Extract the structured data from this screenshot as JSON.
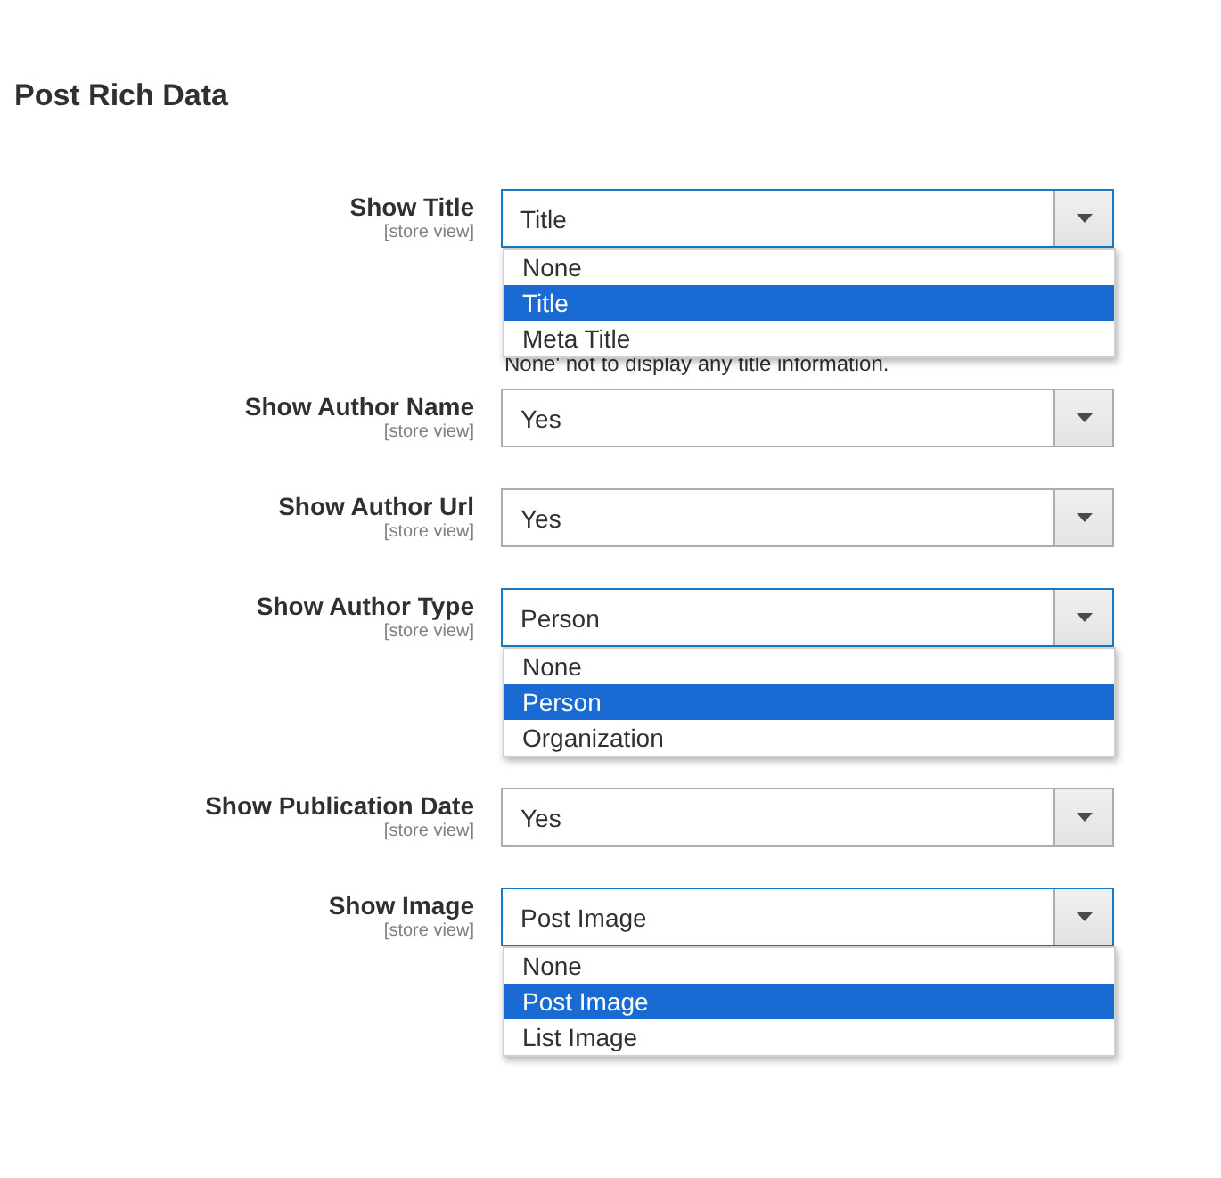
{
  "section": {
    "title": "Post Rich Data"
  },
  "fields": [
    {
      "label": "Show Title",
      "scope": "[store view]",
      "value": "Title",
      "open": true,
      "options": [
        {
          "label": "None",
          "selected": false
        },
        {
          "label": "Title",
          "selected": true
        },
        {
          "label": "Meta Title",
          "selected": false
        }
      ],
      "note": "None' not to display any title information."
    },
    {
      "label": "Show Author Name",
      "scope": "[store view]",
      "value": "Yes",
      "open": false
    },
    {
      "label": "Show Author Url",
      "scope": "[store view]",
      "value": "Yes",
      "open": false
    },
    {
      "label": "Show Author Type",
      "scope": "[store view]",
      "value": "Person",
      "open": true,
      "options": [
        {
          "label": "None",
          "selected": false
        },
        {
          "label": "Person",
          "selected": true
        },
        {
          "label": "Organization",
          "selected": false
        }
      ]
    },
    {
      "label": "Show Publication Date",
      "scope": "[store view]",
      "value": "Yes",
      "open": false
    },
    {
      "label": "Show Image",
      "scope": "[store view]",
      "value": "Post Image",
      "open": true,
      "options": [
        {
          "label": "None",
          "selected": false
        },
        {
          "label": "Post Image",
          "selected": true
        },
        {
          "label": "List Image",
          "selected": false
        }
      ]
    }
  ]
}
